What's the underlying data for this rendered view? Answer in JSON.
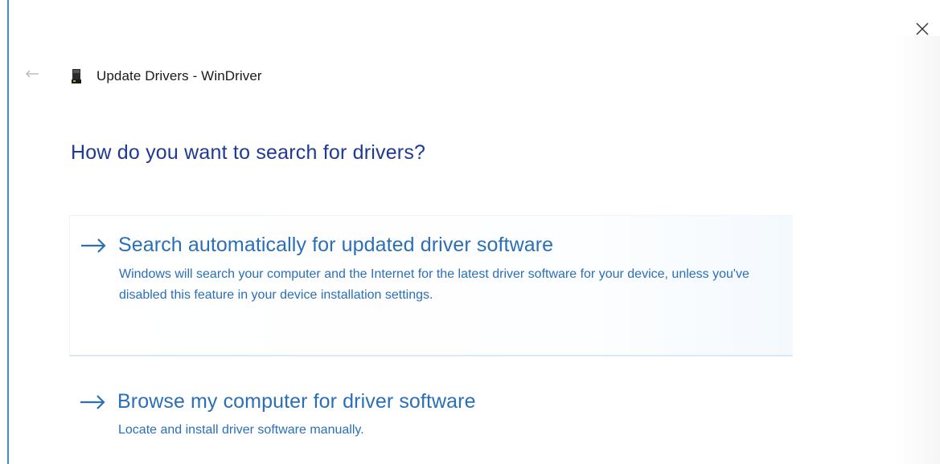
{
  "window": {
    "title": "Update Drivers - WinDriver",
    "close_icon": "close-icon",
    "back_icon": "back-arrow-icon",
    "device_icon": "device-icon"
  },
  "heading": "How do you want to search for drivers?",
  "options": [
    {
      "icon": "arrow-right-icon",
      "title": "Search automatically for updated driver software",
      "description": "Windows will search your computer and the Internet for the latest driver software for your device, unless you've disabled this feature in your device installation settings."
    },
    {
      "icon": "arrow-right-icon",
      "title": "Browse my computer for driver software",
      "description": "Locate and install driver software manually."
    }
  ],
  "colors": {
    "heading": "#1f3a93",
    "link": "#2a6fb7",
    "accent_border": "#3a8fdc"
  }
}
